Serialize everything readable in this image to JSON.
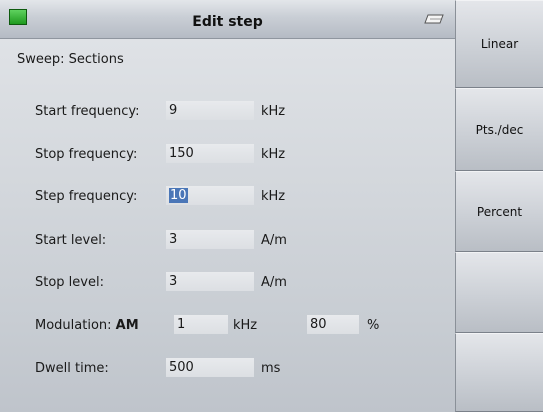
{
  "title": "Edit step",
  "subtitle": "Sweep: Sections",
  "fields": {
    "start_frequency": {
      "label": "Start frequency:",
      "value": "9",
      "unit": "kHz"
    },
    "stop_frequency": {
      "label": "Stop frequency:",
      "value": "150",
      "unit": "kHz"
    },
    "step_frequency": {
      "label": "Step frequency:",
      "value": "10",
      "unit": "kHz"
    },
    "start_level": {
      "label": "Start level:",
      "value": "3",
      "unit": "A/m"
    },
    "stop_level": {
      "label": "Stop level:",
      "value": "3",
      "unit": "A/m"
    },
    "modulation": {
      "label": "Modulation:",
      "type": "AM",
      "frequency": "1",
      "frequency_unit": "kHz",
      "depth": "80",
      "depth_unit": "%"
    },
    "dwell_time": {
      "label": "Dwell time:",
      "value": "500",
      "unit": "ms"
    }
  },
  "softkeys": [
    {
      "label": "Linear"
    },
    {
      "label": "Pts./dec"
    },
    {
      "label": "Percent"
    },
    {
      "label": ""
    },
    {
      "label": ""
    }
  ],
  "colors": {
    "selection": "#4a76b7",
    "status_led": "#2fb22f"
  },
  "icons": {
    "status": "status-led-icon",
    "clear": "eraser-icon"
  }
}
